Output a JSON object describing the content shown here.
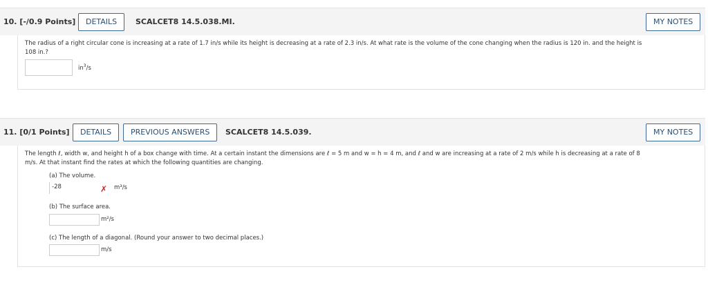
{
  "q10": {
    "number": "10. [-/0.9 Points]",
    "details": "DETAILS",
    "code": "SCALCET8 14.5.038.MI.",
    "my_notes": "MY NOTES",
    "text1": "The radius of a right circular cone is increasing at a rate of 1.7 in/s while its height is decreasing at a rate of 2.3 in/s. At what rate is the volume of the cone changing when the radius is 120 in. and the height is",
    "text2": "108 in.?",
    "answer": "",
    "unit": "in³/s"
  },
  "q11": {
    "number": "11. [0/1 Points]",
    "details": "DETAILS",
    "previous": "PREVIOUS ANSWERS",
    "code": "SCALCET8 14.5.039.",
    "my_notes": "MY NOTES",
    "text1": "The length ℓ, width w, and height h of a box change with time. At a certain instant the dimensions are ℓ = 5 m and  w = h = 4 m,  and ℓ and w are increasing at a rate of 2 m/s while h is decreasing at a rate of 8",
    "text2": "m/s. At that instant find the rates at which the following quantities are changing.",
    "a_label": "(a) The volume.",
    "a_answer": "-28",
    "a_unit": "m³/s",
    "b_label": "(b) The surface area.",
    "b_answer": "",
    "b_unit": "m²/s",
    "c_label": "(c) The length of a diagonal. (Round your answer to two decimal places.)",
    "c_answer": "",
    "c_unit": "m/s"
  },
  "colors": {
    "accent": "#2a4f73",
    "error": "#d0232b",
    "bar": "#f4f4f4"
  },
  "icons": {
    "incorrect": "x-mark-icon"
  }
}
